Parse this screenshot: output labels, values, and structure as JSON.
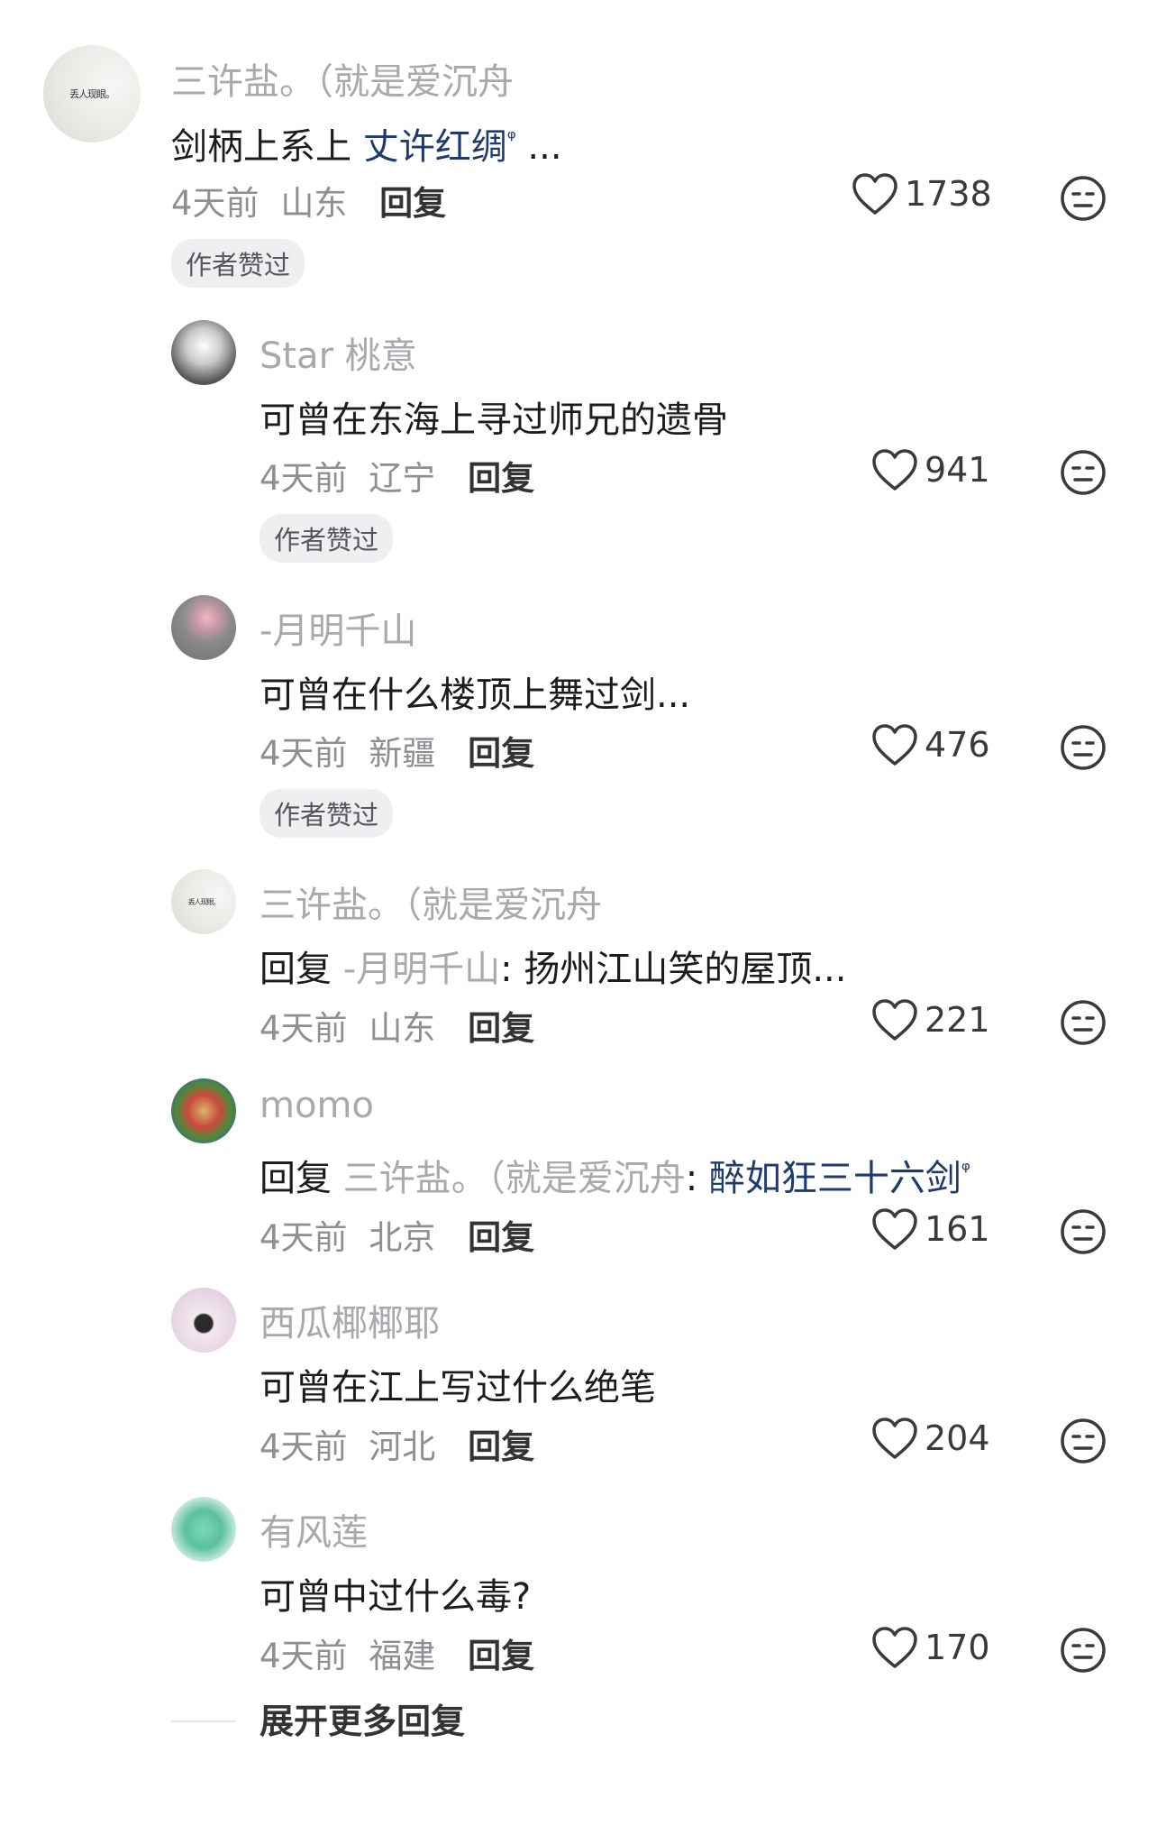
{
  "comments": [
    {
      "name": "三许盐。（就是爱沉舟",
      "text": "剑柄上系上 ",
      "link": "丈许红绸",
      "suffix": " ...",
      "time": "4天前",
      "location": "山东",
      "reply": "回复",
      "likes": "1738",
      "badge": "作者赞过",
      "avatar_text": "丢人现眼。"
    },
    {
      "name": "Star 桃意",
      "text": "可曾在东海上寻过师兄的遗骨",
      "time": "4天前",
      "location": "辽宁",
      "reply": "回复",
      "likes": "941",
      "badge": "作者赞过"
    },
    {
      "name": "-月明千山",
      "text": "可曾在什么楼顶上舞过剑...",
      "time": "4天前",
      "location": "新疆",
      "reply": "回复",
      "likes": "476",
      "badge": "作者赞过"
    },
    {
      "name": "三许盐。（就是爱沉舟",
      "prefix": "回复",
      "target": "-月明千山",
      "text": ": 扬州江山笑的屋顶...",
      "time": "4天前",
      "location": "山东",
      "reply": "回复",
      "likes": "221",
      "avatar_text": "丢人现眼。"
    },
    {
      "name": "momo",
      "prefix": "回复",
      "target": "三许盐。（就是爱沉舟",
      "text": ": ",
      "link": "醉如狂三十六剑",
      "time": "4天前",
      "location": "北京",
      "reply": "回复",
      "likes": "161"
    },
    {
      "name": "西瓜椰椰耶",
      "text": "可曾在江上写过什么绝笔",
      "time": "4天前",
      "location": "河北",
      "reply": "回复",
      "likes": "204"
    },
    {
      "name": "有风莲",
      "text": "可曾中过什么毒?",
      "time": "4天前",
      "location": "福建",
      "reply": "回复",
      "likes": "170"
    }
  ],
  "expand_label": "展开更多回复"
}
